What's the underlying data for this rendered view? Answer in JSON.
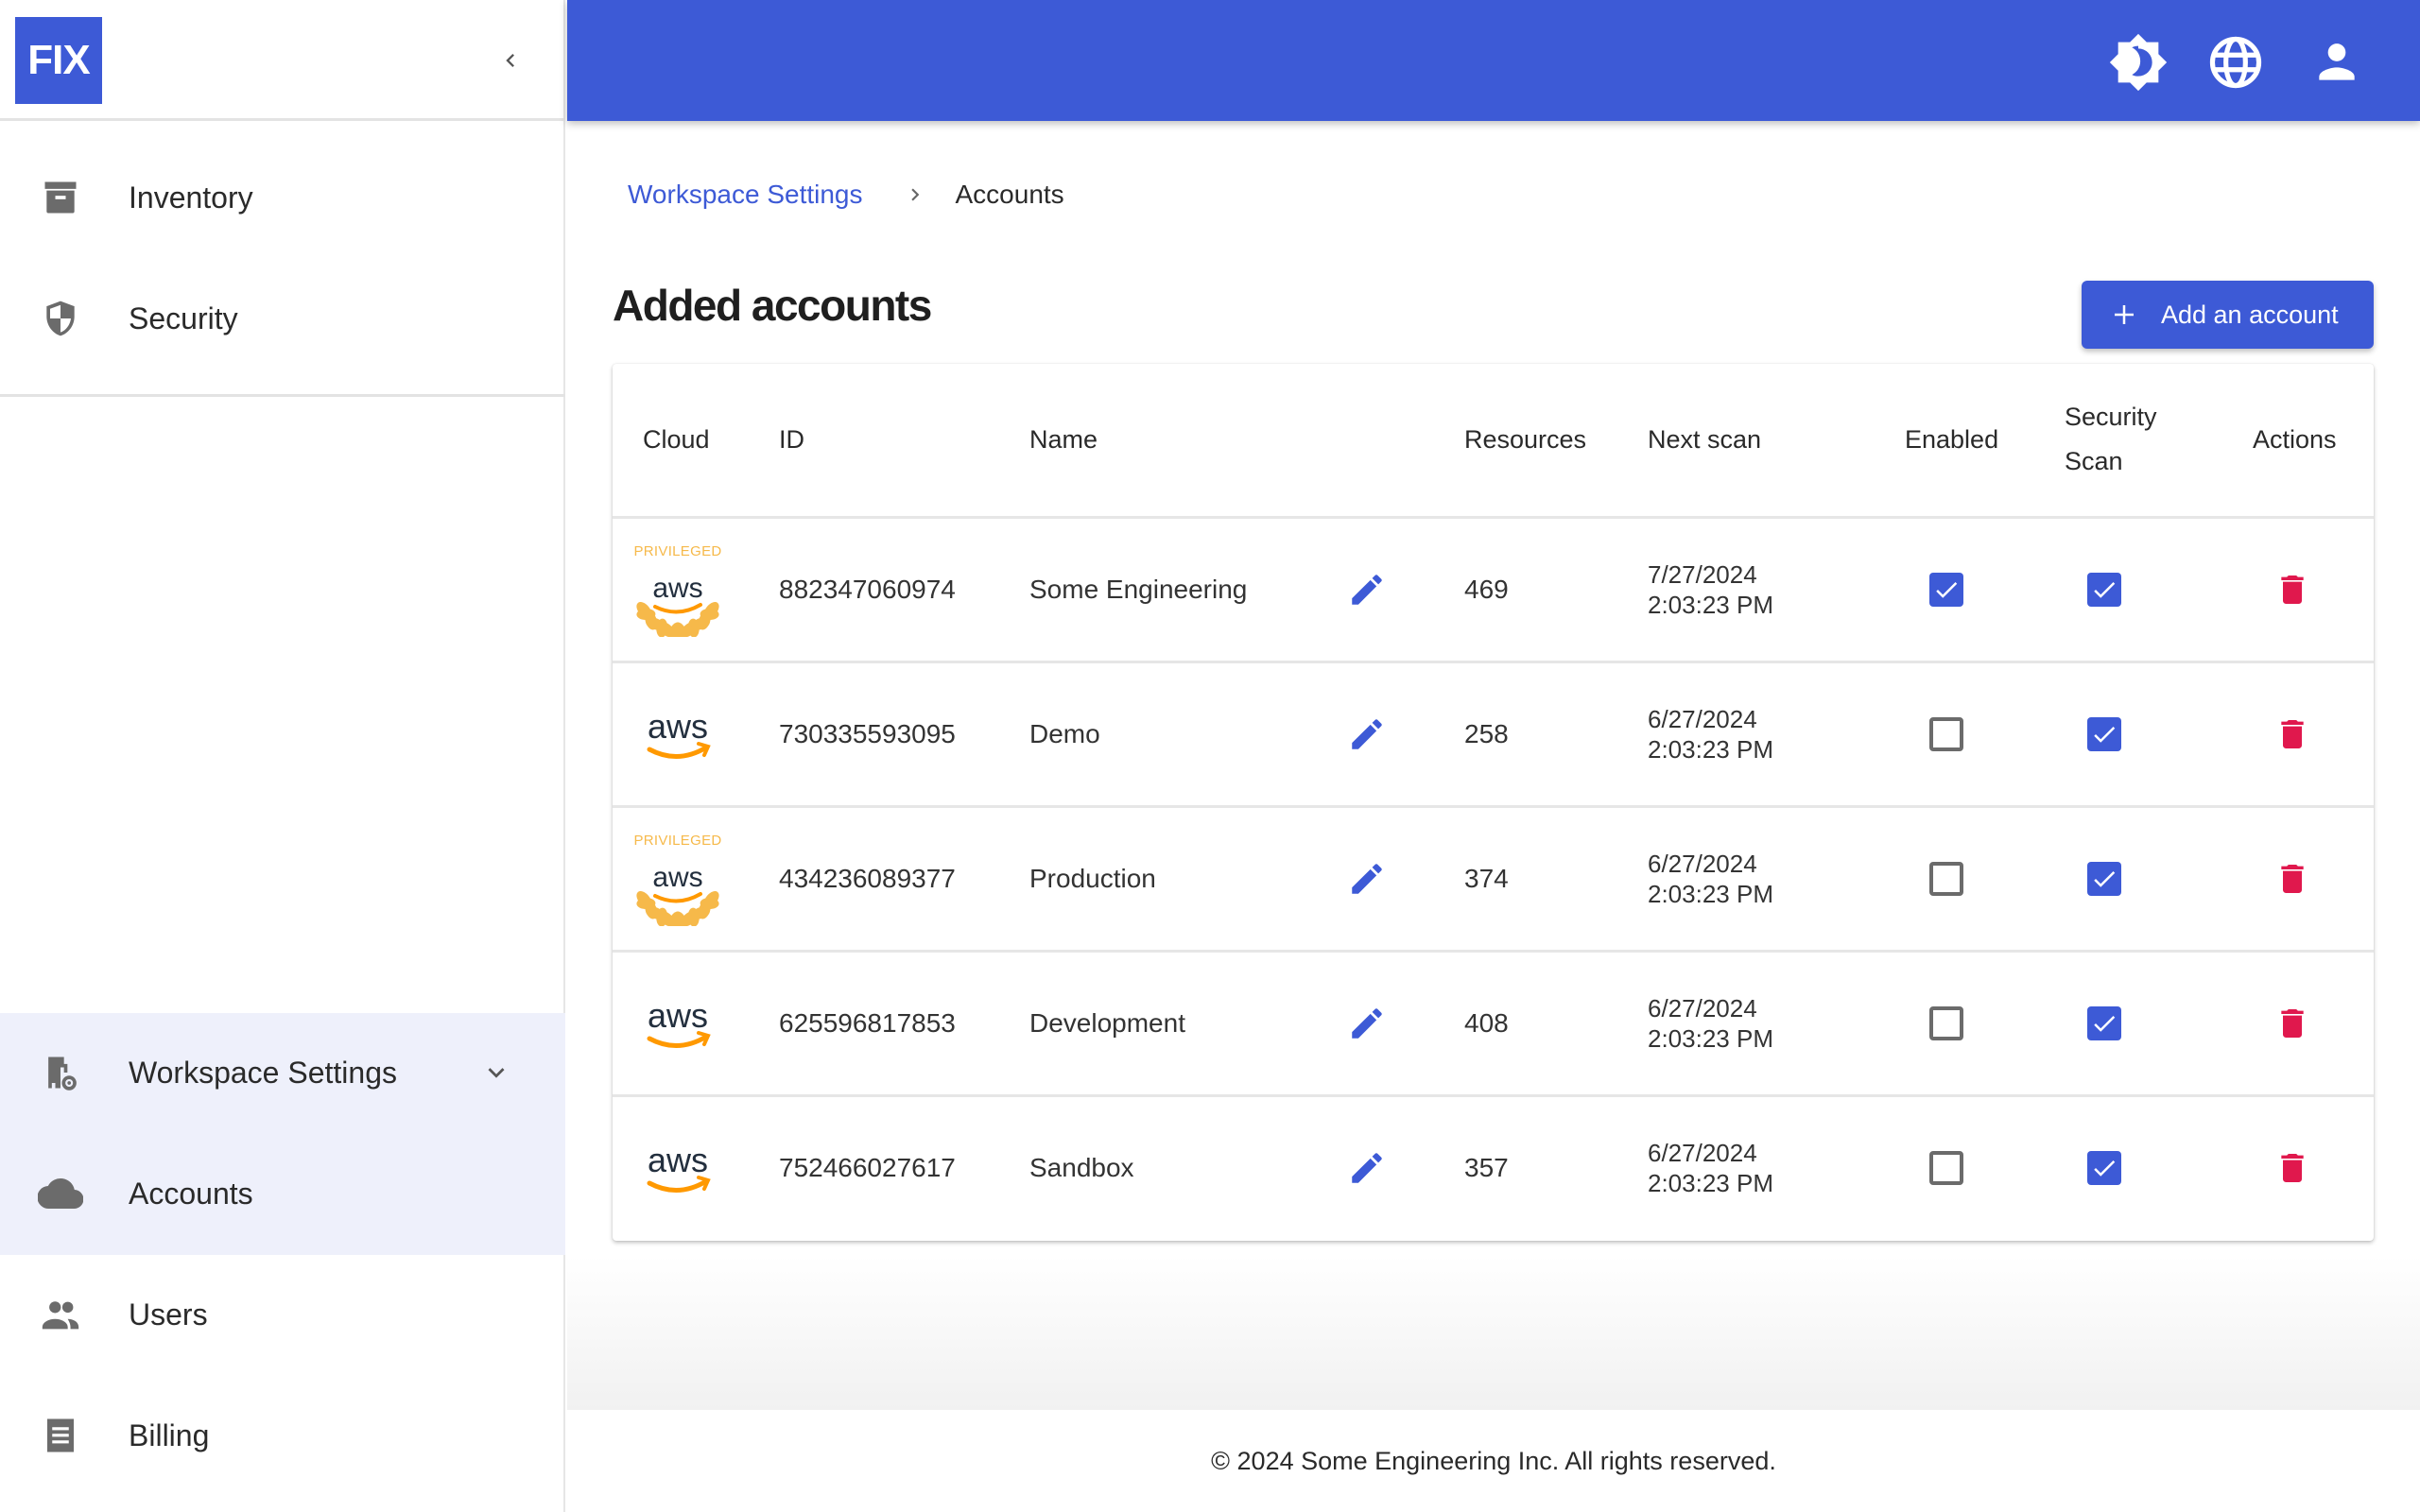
{
  "app": {
    "logo_text": "FIX",
    "brand_color": "#3d5ad6"
  },
  "sidebar": {
    "collapse_icon": "chevron-left-icon",
    "top_items": [
      {
        "label": "Inventory",
        "icon": "archive-box-icon"
      },
      {
        "label": "Security",
        "icon": "shield-icon"
      }
    ],
    "group": {
      "label": "Workspace Settings",
      "icon": "workspace-settings-icon",
      "expanded": true,
      "items": [
        {
          "label": "Accounts",
          "icon": "cloud-icon",
          "active": true
        },
        {
          "label": "Users",
          "icon": "users-icon"
        },
        {
          "label": "Billing",
          "icon": "receipt-icon"
        }
      ]
    }
  },
  "topbar": {
    "icons": [
      "theme-toggle-icon",
      "language-globe-icon",
      "account-user-icon"
    ]
  },
  "breadcrumb": {
    "parent": "Workspace Settings",
    "separator_icon": "chevron-right-icon",
    "current": "Accounts"
  },
  "main": {
    "title": "Added accounts",
    "add_button_label": "Add an account",
    "table": {
      "columns": {
        "cloud": "Cloud",
        "id": "ID",
        "name": "Name",
        "resources": "Resources",
        "next_scan": "Next scan",
        "enabled": "Enabled",
        "security_scan_line1": "Security",
        "security_scan_line2": "Scan",
        "actions": "Actions"
      },
      "rows": [
        {
          "cloud": "aws",
          "privileged": true,
          "privileged_label": "PRIVILEGED",
          "id": "882347060974",
          "name": "Some Engineering",
          "resources": "469",
          "next_scan_date": "7/27/2024",
          "next_scan_time": "2:03:23 PM",
          "enabled": true,
          "security_scan": true
        },
        {
          "cloud": "aws",
          "privileged": false,
          "privileged_label": "",
          "id": "730335593095",
          "name": "Demo",
          "resources": "258",
          "next_scan_date": "6/27/2024",
          "next_scan_time": "2:03:23 PM",
          "enabled": false,
          "security_scan": true
        },
        {
          "cloud": "aws",
          "privileged": true,
          "privileged_label": "PRIVILEGED",
          "id": "434236089377",
          "name": "Production",
          "resources": "374",
          "next_scan_date": "6/27/2024",
          "next_scan_time": "2:03:23 PM",
          "enabled": false,
          "security_scan": true
        },
        {
          "cloud": "aws",
          "privileged": false,
          "privileged_label": "",
          "id": "625596817853",
          "name": "Development",
          "resources": "408",
          "next_scan_date": "6/27/2024",
          "next_scan_time": "2:03:23 PM",
          "enabled": false,
          "security_scan": true
        },
        {
          "cloud": "aws",
          "privileged": false,
          "privileged_label": "",
          "id": "752466027617",
          "name": "Sandbox",
          "resources": "357",
          "next_scan_date": "6/27/2024",
          "next_scan_time": "2:03:23 PM",
          "enabled": false,
          "security_scan": true
        }
      ]
    }
  },
  "footer": {
    "text": "© 2024 Some Engineering Inc. All rights reserved."
  },
  "colors": {
    "accent": "#3d5ad6",
    "delete": "#e0184d",
    "aws_orange": "#f90",
    "privileged_gold": "#f6b94a",
    "active_nav_bg": "#eef0fb"
  }
}
